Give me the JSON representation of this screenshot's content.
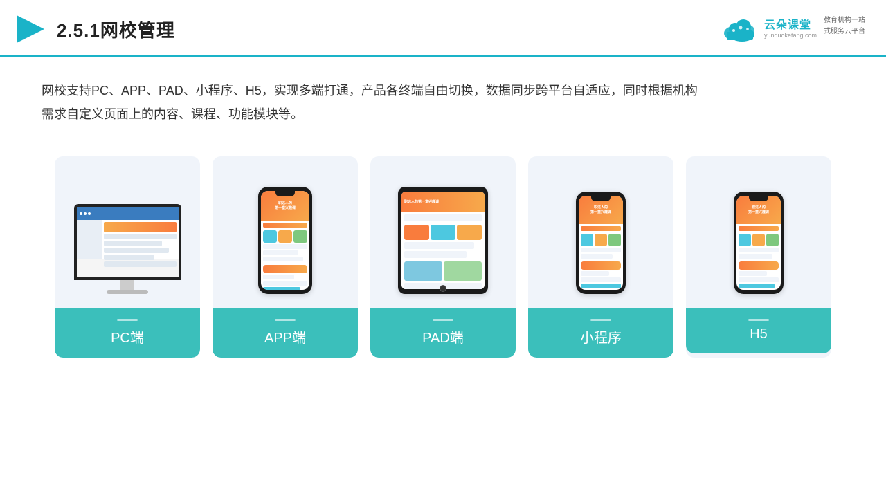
{
  "header": {
    "title": "2.5.1网校管理",
    "logo": {
      "name_cn": "云朵课堂",
      "name_en": "yunduoketang.com",
      "tagline_line1": "教育机构一站",
      "tagline_line2": "式服务云平台"
    }
  },
  "description": {
    "text1": "网校支持PC、APP、PAD、小程序、H5，实现多端打通，产品各终端自由切换，数据同步跨平台自适应，同时根据机构",
    "text2": "需求自定义页面上的内容、课程、功能模块等。"
  },
  "cards": [
    {
      "id": "pc",
      "label": "PC端"
    },
    {
      "id": "app",
      "label": "APP端"
    },
    {
      "id": "pad",
      "label": "PAD端"
    },
    {
      "id": "miniprogram",
      "label": "小程序"
    },
    {
      "id": "h5",
      "label": "H5"
    }
  ]
}
